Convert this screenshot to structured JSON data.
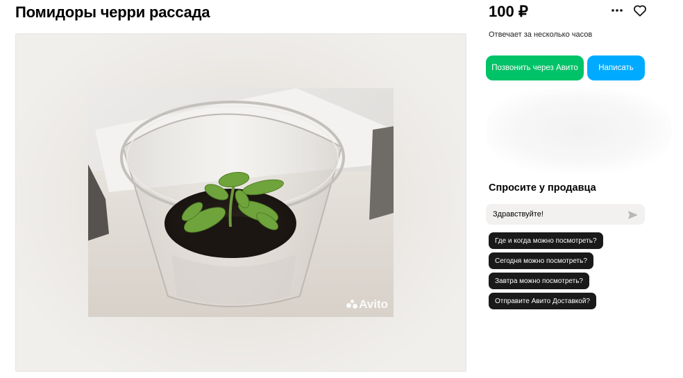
{
  "listing": {
    "title": "Помидоры черри рассада",
    "price": "100 ₽",
    "seller_response": "Отвечает за несколько часов"
  },
  "actions": {
    "call_label": "Позвонить через Авито",
    "write_label": "Написать",
    "call_color": "#00c266",
    "write_color": "#00aaff"
  },
  "gallery": {
    "watermark": "Avito"
  },
  "ask_seller": {
    "title": "Спросите у продавца",
    "input_value": "Здравствуйте!",
    "suggestions": [
      "Где и когда можно посмотреть?",
      "Сегодня можно посмотреть?",
      "Завтра можно посмотреть?",
      "Отправите Авито Доставкой?"
    ]
  },
  "icons": {
    "more": "more-icon",
    "favorite": "heart-icon",
    "send": "send-icon"
  }
}
